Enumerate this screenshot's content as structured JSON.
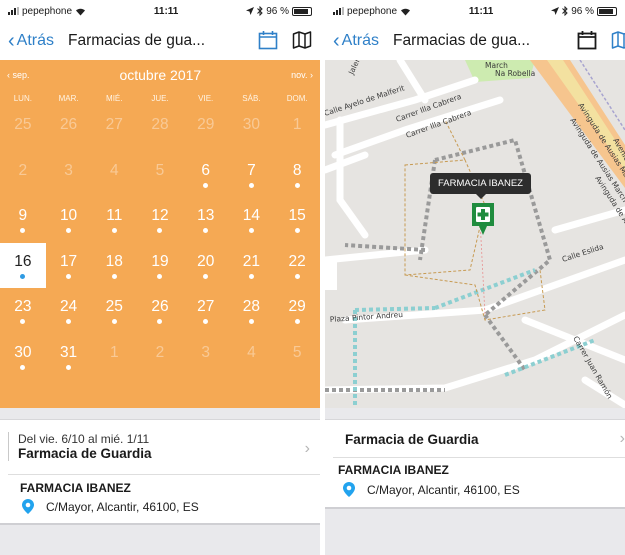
{
  "status": {
    "carrier": "pepephone",
    "time": "11:11",
    "battery": "96 %"
  },
  "nav": {
    "back_label": "Atrás",
    "title": "Farmacias de gua..."
  },
  "calendar": {
    "prev": "‹ sep.",
    "month": "octubre 2017",
    "next": "nov. ›",
    "weekdays": [
      "LUN.",
      "MAR.",
      "MIÉ.",
      "JUE.",
      "VIE.",
      "SÁB.",
      "DOM."
    ],
    "weeks": [
      [
        {
          "d": "25",
          "dim": true
        },
        {
          "d": "26",
          "dim": true
        },
        {
          "d": "27",
          "dim": true
        },
        {
          "d": "28",
          "dim": true
        },
        {
          "d": "29",
          "dim": true
        },
        {
          "d": "30",
          "dim": true
        },
        {
          "d": "1",
          "dim": true
        }
      ],
      [
        {
          "d": "2",
          "dim": true
        },
        {
          "d": "3",
          "dim": true
        },
        {
          "d": "4",
          "dim": true
        },
        {
          "d": "5",
          "dim": true
        },
        {
          "d": "6",
          "dot": true
        },
        {
          "d": "7",
          "dot": true
        },
        {
          "d": "8",
          "dot": true
        }
      ],
      [
        {
          "d": "9",
          "dot": true
        },
        {
          "d": "10",
          "dot": true
        },
        {
          "d": "11",
          "dot": true
        },
        {
          "d": "12",
          "dot": true
        },
        {
          "d": "13",
          "dot": true
        },
        {
          "d": "14",
          "dot": true
        },
        {
          "d": "15",
          "dot": true
        }
      ],
      [
        {
          "d": "16",
          "dot": true,
          "selected": true
        },
        {
          "d": "17",
          "dot": true
        },
        {
          "d": "18",
          "dot": true
        },
        {
          "d": "19",
          "dot": true
        },
        {
          "d": "20",
          "dot": true
        },
        {
          "d": "21",
          "dot": true
        },
        {
          "d": "22",
          "dot": true
        }
      ],
      [
        {
          "d": "23",
          "dot": true
        },
        {
          "d": "24",
          "dot": true
        },
        {
          "d": "25",
          "dot": true
        },
        {
          "d": "26",
          "dot": true
        },
        {
          "d": "27",
          "dot": true
        },
        {
          "d": "28",
          "dot": true
        },
        {
          "d": "29",
          "dot": true
        }
      ],
      [
        {
          "d": "30",
          "dot": true
        },
        {
          "d": "31",
          "dot": true
        },
        {
          "d": "1",
          "dim": true
        },
        {
          "d": "2",
          "dim": true
        },
        {
          "d": "3",
          "dim": true
        },
        {
          "d": "4",
          "dim": true
        },
        {
          "d": "5",
          "dim": true
        }
      ]
    ]
  },
  "guard": {
    "range": "Del vie. 6/10 al mié. 1/11",
    "title": "Farmacia de Guardia",
    "pharmacy": "FARMACIA IBANEZ",
    "address": "C/Mayor, Alcantir, 46100, ES"
  },
  "map": {
    "tooltip": "FARMACIA IBANEZ",
    "streets": {
      "s1": "Calle Ayelo de Malferit",
      "s2": "Carrer Illa Cabrera",
      "s3": "Carrer Illa Cabrera",
      "s4": "Avinguda de Ausias March",
      "s5": "Avinguda de Ausias March",
      "s6": "Avinguda de Ausias",
      "s7": "Calle Eslida",
      "s8": "Plaza Pintor Andreu",
      "s9": "Carrer Juan Ramón",
      "s10": "Jaler",
      "s11": "March",
      "s12": "Na Robella",
      "s13": "Avenida"
    }
  },
  "colors": {
    "accent": "#2f80c8",
    "calendar": "#f5a954",
    "marker": "#1f8c3e"
  },
  "icons": {
    "calendar": "calendar-icon",
    "map": "map-icon",
    "location": "location-pin-icon"
  }
}
